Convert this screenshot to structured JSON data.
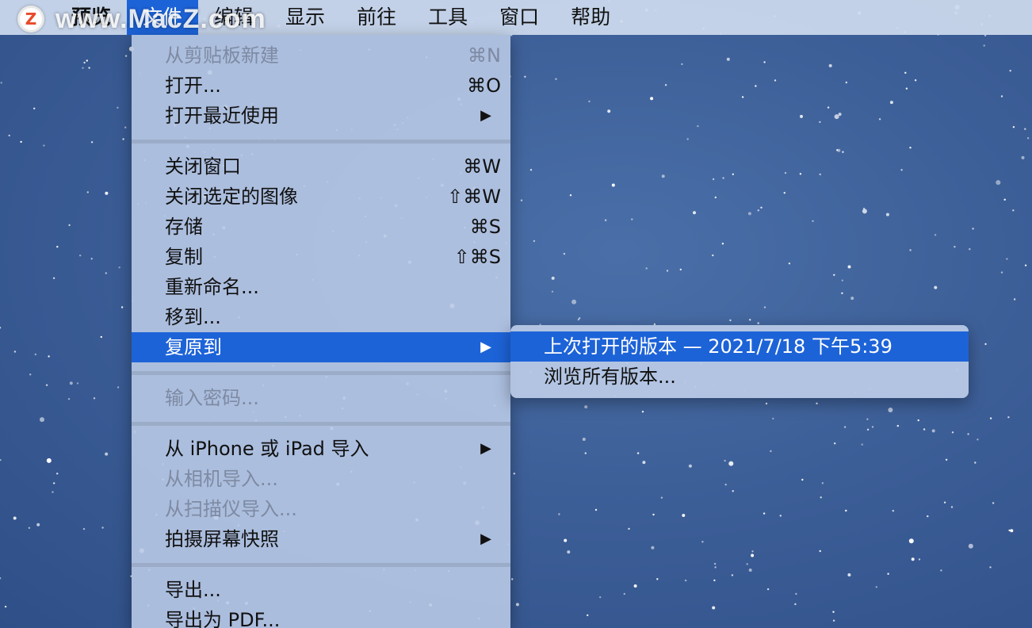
{
  "menubar": {
    "items": [
      {
        "label": "预览"
      },
      {
        "label": "文件"
      },
      {
        "label": "编辑"
      },
      {
        "label": "显示"
      },
      {
        "label": "前往"
      },
      {
        "label": "工具"
      },
      {
        "label": "窗口"
      },
      {
        "label": "帮助"
      }
    ],
    "active_item": "文件"
  },
  "watermark": {
    "logo_letter": "Z",
    "text": "www.MacZ.com"
  },
  "file_menu": {
    "new_from_clipboard": {
      "label": "从剪贴板新建",
      "shortcut": "⌘N",
      "enabled": false
    },
    "open": {
      "label": "打开...",
      "shortcut": "⌘O"
    },
    "open_recent": {
      "label": "打开最近使用",
      "arrow": "▶"
    },
    "close_window": {
      "label": "关闭窗口",
      "shortcut": "⌘W"
    },
    "close_selected_images": {
      "label": "关闭选定的图像",
      "shortcut": "⇧⌘W"
    },
    "save": {
      "label": "存储",
      "shortcut": "⌘S"
    },
    "duplicate": {
      "label": "复制",
      "shortcut": "⇧⌘S"
    },
    "rename": {
      "label": "重新命名..."
    },
    "move_to": {
      "label": "移到..."
    },
    "revert_to": {
      "label": "复原到",
      "arrow": "▶",
      "highlighted": true
    },
    "enter_password": {
      "label": "输入密码...",
      "enabled": false
    },
    "import_from_iphone": {
      "label": "从 iPhone 或 iPad 导入",
      "arrow": "▶"
    },
    "import_from_camera": {
      "label": "从相机导入...",
      "enabled": false
    },
    "import_from_scanner": {
      "label": "从扫描仪导入...",
      "enabled": false
    },
    "take_screenshot": {
      "label": "拍摄屏幕快照",
      "arrow": "▶"
    },
    "export": {
      "label": "导出..."
    },
    "export_pdf": {
      "label": "导出为 PDF..."
    }
  },
  "revert_submenu": {
    "items": [
      {
        "label": "上次打开的版本 — 2021/7/18 下午5:39",
        "highlighted": true
      },
      {
        "label": "浏览所有版本..."
      }
    ]
  },
  "colors": {
    "highlight": "#1d63d8",
    "menu_bg": "#b8c9e6",
    "desktop": "#3d5f98"
  }
}
